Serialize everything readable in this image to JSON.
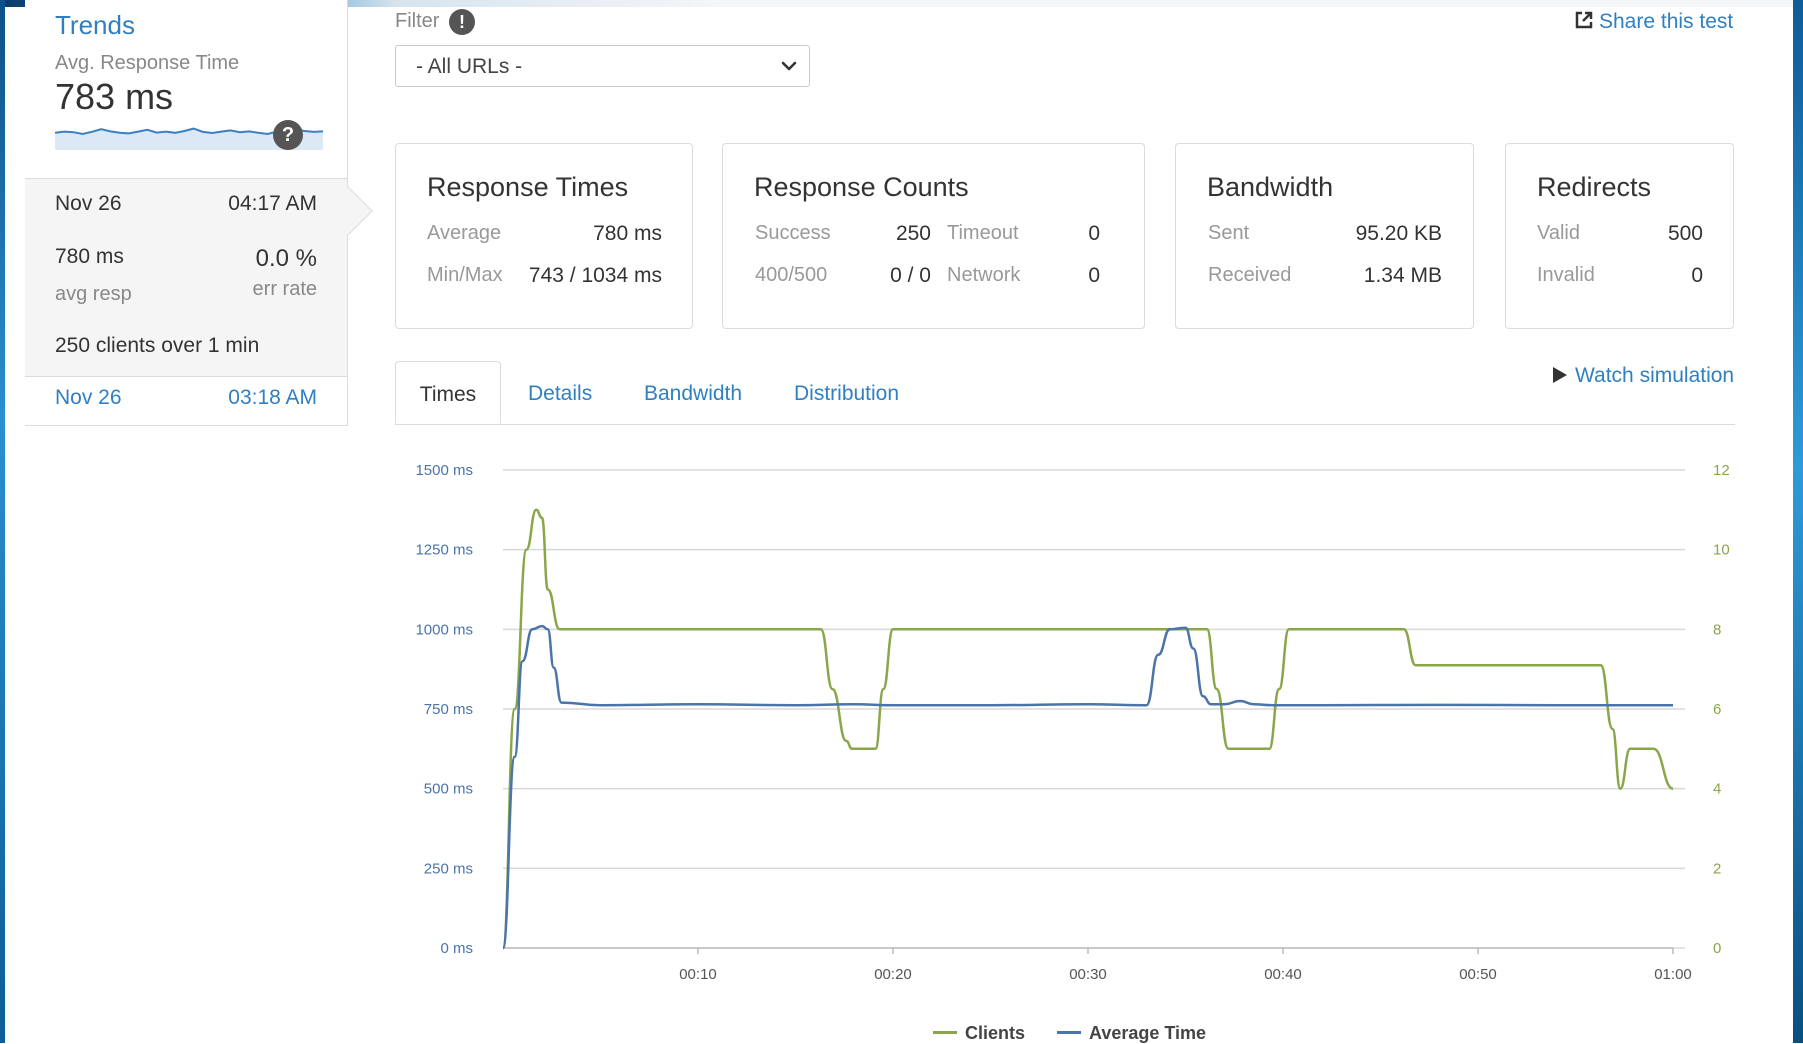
{
  "sidebar": {
    "trends_title": "Trends",
    "avg_label": "Avg. Response Time",
    "avg_value": "783 ms",
    "help_icon_text": "?",
    "active_run": {
      "date": "Nov 26",
      "time": "04:17 AM",
      "avg_resp_value": "780 ms",
      "avg_resp_label": "avg resp",
      "err_rate_value": "0.0 %",
      "err_rate_label": "err rate",
      "clients_text": "250 clients over 1 min"
    },
    "other_run": {
      "date": "Nov 26",
      "time": "03:18 AM"
    }
  },
  "filter": {
    "label": "Filter",
    "info_icon_text": "!",
    "selected": "- All URLs -"
  },
  "share_label": "Share this test",
  "cards": {
    "response_times": {
      "title": "Response Times",
      "average_label": "Average",
      "average_value": "780 ms",
      "minmax_label": "Min/Max",
      "minmax_value": "743 / 1034 ms"
    },
    "response_counts": {
      "title": "Response Counts",
      "success_label": "Success",
      "success_value": "250",
      "timeout_label": "Timeout",
      "timeout_value": "0",
      "errors_label": "400/500",
      "errors_value": "0 / 0",
      "network_label": "Network",
      "network_value": "0"
    },
    "bandwidth": {
      "title": "Bandwidth",
      "sent_label": "Sent",
      "sent_value": "95.20 KB",
      "received_label": "Received",
      "received_value": "1.34 MB"
    },
    "redirects": {
      "title": "Redirects",
      "valid_label": "Valid",
      "valid_value": "500",
      "invalid_label": "Invalid",
      "invalid_value": "0"
    }
  },
  "tabs": [
    {
      "label": "Times"
    },
    {
      "label": "Details"
    },
    {
      "label": "Bandwidth"
    },
    {
      "label": "Distribution"
    }
  ],
  "watch_label": "Watch simulation",
  "colors": {
    "accent": "#2f7fc1",
    "clients_line": "#8aa64a",
    "avg_time_line": "#4a74aa"
  },
  "chart_data": {
    "type": "line",
    "x_ticks": [
      "00:10",
      "00:20",
      "00:30",
      "00:40",
      "00:50",
      "01:00"
    ],
    "x_tick_values": [
      10,
      20,
      30,
      40,
      50,
      60
    ],
    "xlim": [
      0,
      60
    ],
    "y_left_ticks": [
      "0 ms",
      "250 ms",
      "500 ms",
      "750 ms",
      "1000 ms",
      "1250 ms",
      "1500 ms"
    ],
    "y_left_tick_values": [
      0,
      250,
      500,
      750,
      1000,
      1250,
      1500
    ],
    "ylim_left": [
      0,
      1500
    ],
    "y_right_ticks": [
      "0",
      "2",
      "4",
      "6",
      "8",
      "10",
      "12"
    ],
    "y_right_tick_values": [
      0,
      2,
      4,
      6,
      8,
      10,
      12
    ],
    "ylim_right": [
      0,
      12
    ],
    "grid": true,
    "legend_position": "bottom-center",
    "series": [
      {
        "name": "Clients",
        "axis": "right",
        "x": [
          0,
          0.6,
          1.2,
          1.7,
          2.0,
          2.3,
          2.9,
          16.3,
          16.9,
          17.6,
          17.9,
          19.1,
          19.5,
          20.0,
          20.3,
          36.1,
          36.6,
          37.2,
          39.3,
          39.8,
          40.3,
          46.2,
          46.8,
          56.3,
          56.9,
          57.3,
          57.8,
          59.0,
          60.0
        ],
        "values": [
          0,
          6,
          10,
          11,
          10.8,
          9,
          8,
          8,
          6.5,
          5.2,
          5,
          5,
          6.5,
          8,
          8,
          8,
          6.5,
          5,
          5,
          6.5,
          8,
          8,
          7.1,
          7.1,
          5.5,
          4,
          5,
          5,
          4
        ]
      },
      {
        "name": "Average Time",
        "axis": "left",
        "x": [
          0,
          0.6,
          1.0,
          1.5,
          2.0,
          2.3,
          2.6,
          3.0,
          5,
          10,
          15,
          18,
          20,
          25,
          30,
          33,
          33.6,
          34.2,
          35.0,
          35.4,
          35.9,
          36.3,
          37,
          37.8,
          38.5,
          39.5,
          42,
          48,
          54,
          60
        ],
        "values": [
          0,
          600,
          900,
          1000,
          1010,
          1000,
          880,
          770,
          762,
          765,
          762,
          765,
          762,
          762,
          765,
          762,
          920,
          1000,
          1005,
          940,
          790,
          765,
          765,
          775,
          765,
          762,
          762,
          763,
          762,
          762
        ]
      }
    ]
  },
  "sparkline_values": [
    760,
    770,
    765,
    750,
    768,
    790,
    772,
    760,
    755,
    770,
    785,
    762,
    770,
    760,
    775,
    795,
    768,
    758,
    770,
    780,
    765,
    772,
    760,
    750,
    770,
    785,
    790,
    775,
    768,
    772
  ]
}
